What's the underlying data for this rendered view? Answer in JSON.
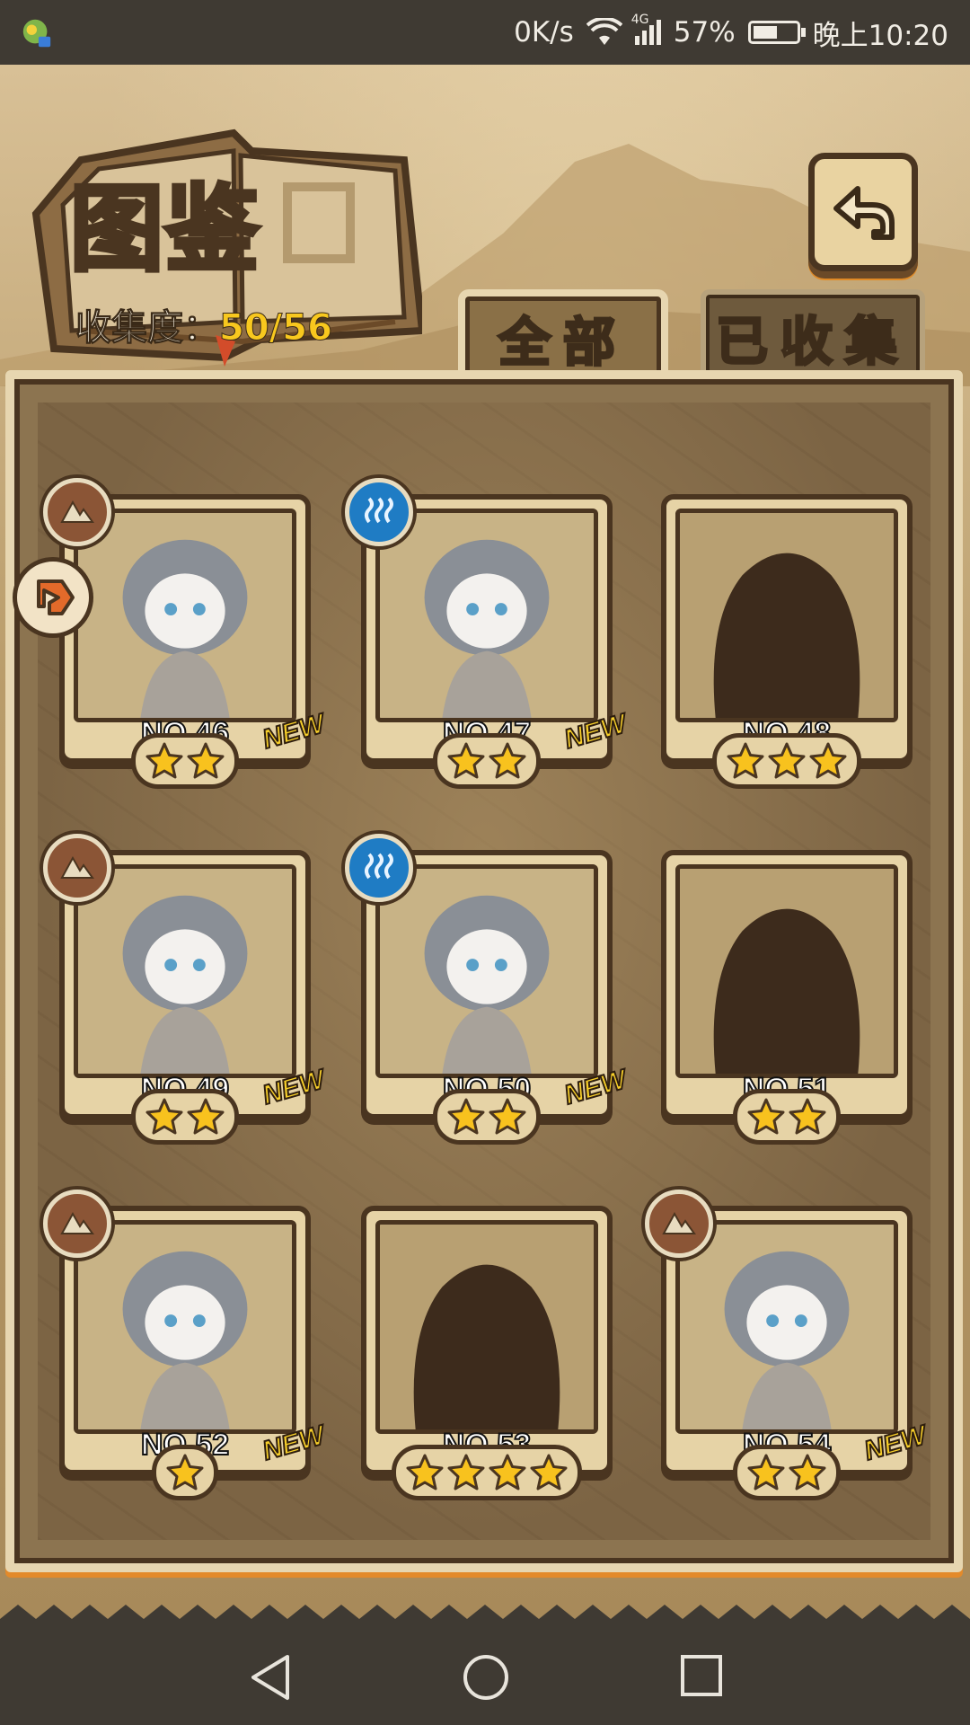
{
  "status_bar": {
    "speed": "0K/s",
    "network": "4G",
    "battery": "57%",
    "battery_level": 0.57,
    "time": "晚上10:20"
  },
  "header": {
    "title": "图鉴",
    "collect_label": "收集度：",
    "collect_value": "50/56"
  },
  "tabs": {
    "all": "全部",
    "collected": "已收集",
    "active": "all"
  },
  "cards": [
    {
      "num": "NO.46",
      "stars": 2,
      "new": "NEW",
      "element": "earth-icon",
      "silhouette": false
    },
    {
      "num": "NO.47",
      "stars": 2,
      "new": "NEW",
      "element": "water-icon",
      "silhouette": false
    },
    {
      "num": "NO.48",
      "stars": 3,
      "new": "",
      "element": "",
      "silhouette": true
    },
    {
      "num": "NO.49",
      "stars": 2,
      "new": "NEW",
      "element": "earth-icon",
      "silhouette": false
    },
    {
      "num": "NO.50",
      "stars": 2,
      "new": "NEW",
      "element": "water-icon",
      "silhouette": false
    },
    {
      "num": "NO.51",
      "stars": 2,
      "new": "",
      "element": "",
      "silhouette": true
    },
    {
      "num": "NO.52",
      "stars": 1,
      "new": "NEW",
      "element": "earth-icon",
      "silhouette": false
    },
    {
      "num": "NO.53",
      "stars": 4,
      "new": "",
      "element": "",
      "silhouette": true
    },
    {
      "num": "NO.54",
      "stars": 2,
      "new": "NEW",
      "element": "earth-icon",
      "silhouette": false
    }
  ],
  "colors": {
    "star": "#f8c21e",
    "earth_badge": "#8b5536",
    "water_badge": "#1f7cc4",
    "collect_value": "#f8c81e"
  }
}
